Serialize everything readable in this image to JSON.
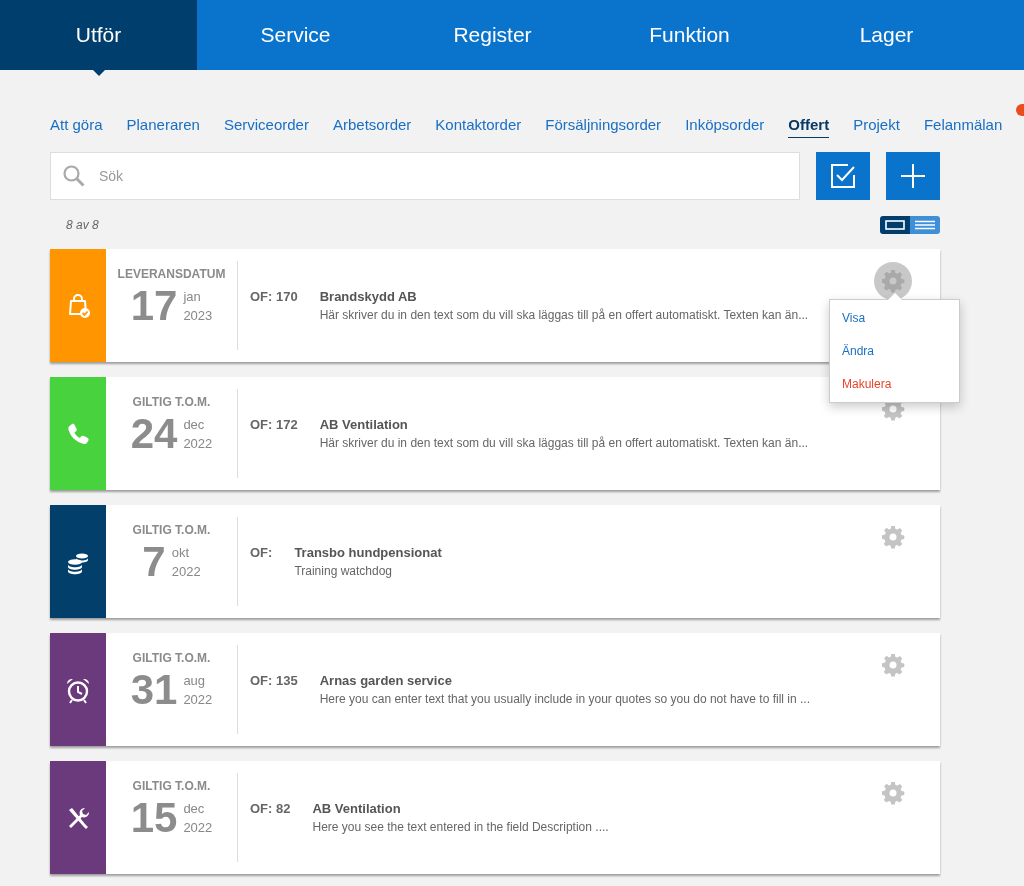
{
  "top_nav": [
    {
      "label": "Utför",
      "selected": true
    },
    {
      "label": "Service",
      "selected": false
    },
    {
      "label": "Register",
      "selected": false
    },
    {
      "label": "Funktion",
      "selected": false
    },
    {
      "label": "Lager",
      "selected": false
    }
  ],
  "sub_tabs": [
    {
      "label": "Att göra",
      "selected": false
    },
    {
      "label": "Planeraren",
      "selected": false
    },
    {
      "label": "Serviceorder",
      "selected": false
    },
    {
      "label": "Arbetsorder",
      "selected": false
    },
    {
      "label": "Kontaktorder",
      "selected": false
    },
    {
      "label": "Försäljningsorder",
      "selected": false
    },
    {
      "label": "Inköpsorder",
      "selected": false
    },
    {
      "label": "Offert",
      "selected": true
    },
    {
      "label": "Projekt",
      "selected": false
    },
    {
      "label": "Felanmälan",
      "selected": false
    }
  ],
  "search": {
    "placeholder": "Sök"
  },
  "count": "8 av 8",
  "view_toggle": [
    {
      "kind": "card",
      "selected": true
    },
    {
      "kind": "list",
      "selected": false
    }
  ],
  "cards": [
    {
      "kind": "bag",
      "color": "#ff9500",
      "label": "LEVERANSDATUM",
      "day": "17",
      "month": "jan",
      "year": "2023",
      "of": "OF: 170",
      "customer": "Brandskydd AB",
      "description": "Här skriver du in den text som du vill ska läggas till på en offert automatiskt. Texten kan än...",
      "menu_open": true
    },
    {
      "kind": "phone",
      "color": "#48d33e",
      "label": "GILTIG T.O.M.",
      "day": "24",
      "month": "dec",
      "year": "2022",
      "of": "OF: 172",
      "customer": "AB Ventilation",
      "description": "Här skriver du in den text som du vill ska läggas till på en offert automatiskt. Texten kan än...",
      "menu_open": false
    },
    {
      "kind": "coins",
      "color": "#033f6b",
      "label": "GILTIG T.O.M.",
      "day": "7",
      "month": "okt",
      "year": "2022",
      "of": "OF:",
      "customer": "Transbo hundpensionat",
      "description": "Training watchdog",
      "menu_open": false
    },
    {
      "kind": "alarm",
      "color": "#6a3a7c",
      "label": "GILTIG T.O.M.",
      "day": "31",
      "month": "aug",
      "year": "2022",
      "of": "OF: 135",
      "customer": "Arnas garden service",
      "description": "Here you can enter text that you usually include in your quotes so you do not have to fill in ...",
      "menu_open": false
    },
    {
      "kind": "tools",
      "color": "#6a3a7c",
      "label": "GILTIG T.O.M.",
      "day": "15",
      "month": "dec",
      "year": "2022",
      "of": "OF: 82",
      "customer": "AB Ventilation",
      "description": "Here you see the text entered in the field Description ....",
      "menu_open": false
    }
  ],
  "action_menu": [
    {
      "label": "Visa",
      "kind": "normal"
    },
    {
      "label": "Ändra",
      "kind": "normal"
    },
    {
      "label": "Makulera",
      "kind": "danger"
    }
  ]
}
